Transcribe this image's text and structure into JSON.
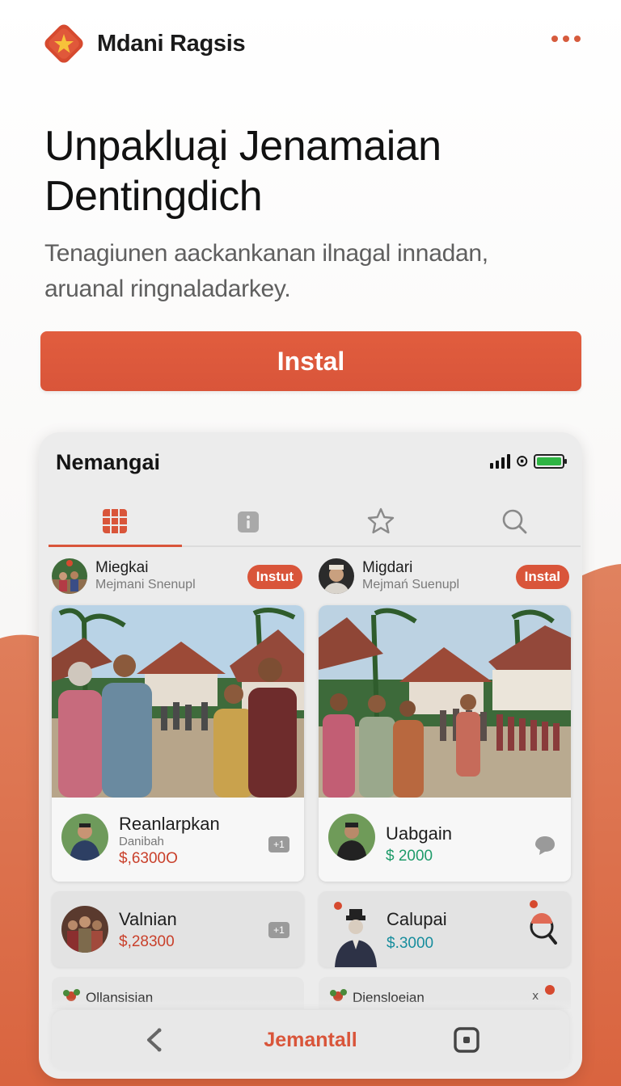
{
  "app": {
    "brand": "Mdani Ragsis",
    "more_icon": "more-horizontal-icon"
  },
  "hero": {
    "title_line1": "Unpakluąi Jenamaian",
    "title_line2": "Dentingdich",
    "sub_line1": "Tenagiunen aackankanan ilnagal innadan,",
    "sub_line2": "aruanal ringnaladarkey."
  },
  "install_label": "Instal",
  "phone": {
    "title": "Nemangai",
    "status_icons": [
      "signal-icon",
      "wifi-icon",
      "battery-icon"
    ],
    "tabs": [
      {
        "icon": "grid-icon",
        "active": true
      },
      {
        "icon": "info-icon",
        "active": false
      },
      {
        "icon": "star-icon",
        "active": false
      },
      {
        "icon": "search-icon",
        "active": false
      }
    ],
    "left": {
      "author": {
        "name": "Miegkai",
        "sub": "Mejmani Snenupl",
        "pill": "Instut"
      },
      "post": {
        "title": "Reanlarpkan",
        "sub": "Danibah",
        "price": "$,6300O"
      },
      "mini": {
        "title": "Valnian",
        "price": "$,28300"
      },
      "peek": "Ollansisian"
    },
    "right": {
      "author": {
        "name": "Migdari",
        "sub": "Mejmań Suenupl",
        "pill": "Instal"
      },
      "post": {
        "title": "Uabgain",
        "price": "$ 2000"
      },
      "mini": {
        "title": "Calupai",
        "price": "$.3000"
      },
      "peek": "Diensloeian"
    },
    "bottom": {
      "center_label": "Jemantall",
      "back_icon": "chevron-left-icon",
      "square_icon": "square-icon"
    }
  },
  "colors": {
    "accent": "#d9553a",
    "green": "#1f9b6a",
    "teal": "#178d9d"
  }
}
